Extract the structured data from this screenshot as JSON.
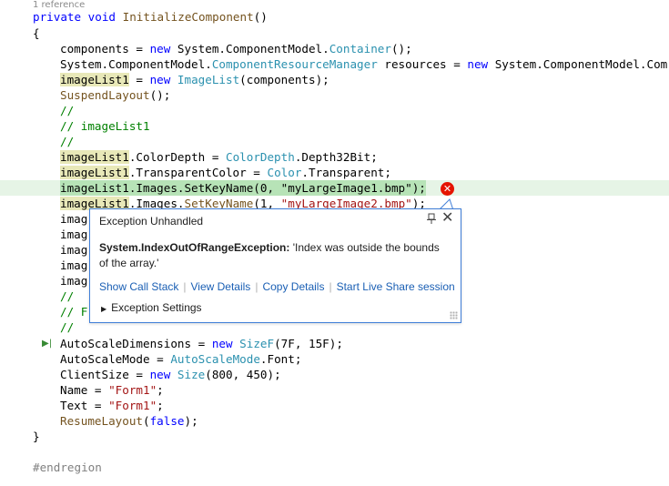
{
  "codelens": "1 reference",
  "lines": {
    "l1": {
      "kw": "private",
      "kw2": "void",
      "method": "InitializeComponent",
      "rest": "()"
    },
    "l2": "{",
    "l3": {
      "a": "components = ",
      "kw": "new",
      "b": " System.ComponentModel.",
      "type": "Container",
      "c": "();"
    },
    "l4": {
      "a": "System.ComponentModel.",
      "type": "ComponentResourceManager",
      "b": " resources = ",
      "kw": "new",
      "c": " System.ComponentModel.Com"
    },
    "l5": {
      "a": "imageList1",
      "b": " = ",
      "kw": "new",
      "sp": " ",
      "type": "ImageList",
      "c": "(components);"
    },
    "l6": {
      "method": "SuspendLayout",
      "rest": "();"
    },
    "l7": "//",
    "l8": "// imageList1",
    "l9": "//",
    "l10": {
      "a": "imageList1",
      "b": ".ColorDepth = ",
      "type": "ColorDepth",
      "c": ".Depth32Bit;"
    },
    "l11": {
      "a": "imageList1",
      "b": ".TransparentColor = ",
      "type": "Color",
      "c": ".Transparent;"
    },
    "l12": {
      "a": "imageList1.Images.SetKeyName(0, ",
      "str": "\"myLargeImage1.bmp\"",
      "c": ");"
    },
    "l13": {
      "a": "imageList1",
      "b": ".Images.",
      "method": "SetKeyName",
      "c": "(1, ",
      "str": "\"myLargeImage2.bmp\"",
      "d": ");"
    },
    "l14": "imag",
    "l15": "imag",
    "l16": "imag",
    "l17": "imag",
    "l18": "imag",
    "l19": "//",
    "l20": "// F",
    "l21": "//",
    "l22": {
      "a": "AutoScaleDimensions = ",
      "kw": "new",
      "sp": " ",
      "type": "SizeF",
      "c": "(7F, 15F);"
    },
    "l23": {
      "a": "AutoScaleMode = ",
      "type": "AutoScaleMode",
      "c": ".Font;"
    },
    "l24": {
      "a": "ClientSize = ",
      "kw": "new",
      "sp": " ",
      "type": "Size",
      "c": "(800, 450);"
    },
    "l25": {
      "a": "Name = ",
      "str": "\"Form1\"",
      "c": ";"
    },
    "l26": {
      "a": "Text = ",
      "str": "\"Form1\"",
      "c": ";"
    },
    "l27": {
      "method": "ResumeLayout",
      "a": "(",
      "kw": "false",
      "c": ");"
    },
    "l28": "}",
    "l29": "#endregion"
  },
  "popup": {
    "title": "Exception Unhandled",
    "exception_type": "System.IndexOutOfRangeException:",
    "message": " 'Index was outside the bounds of the array.'",
    "links": [
      "Show Call Stack",
      "View Details",
      "Copy Details",
      "Start Live Share session"
    ],
    "settings_label": "Exception Settings"
  },
  "colors": {
    "keyword": "#0000ff",
    "type": "#2b91af",
    "string": "#a31515",
    "comment": "#008000",
    "error": "#e51400",
    "link": "#1a5fb4",
    "highlight": "#b7e3b7"
  },
  "icons": {
    "error": "error-circle-icon",
    "pin": "pin-icon",
    "close": "close-icon",
    "next_statement": "next-statement-arrow-icon",
    "expand": "triangle-right-icon"
  }
}
